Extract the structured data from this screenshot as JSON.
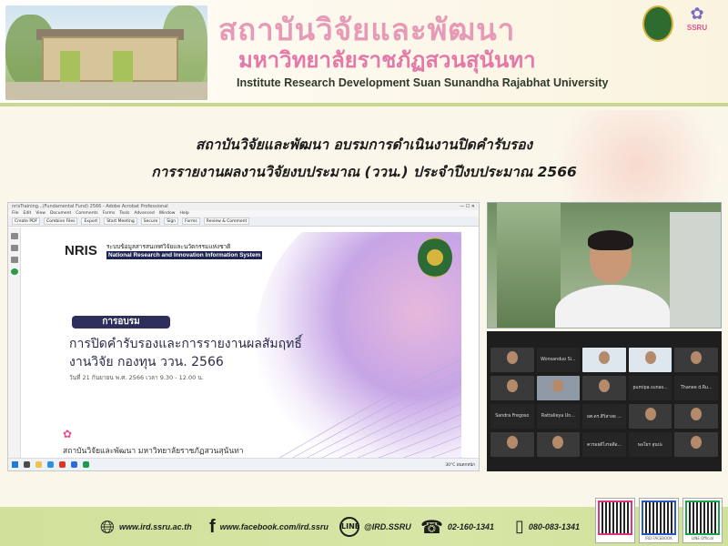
{
  "header": {
    "title_th_line1": "สถาบันวิจัยและพัฒนา",
    "title_th_line2": "มหาวิทยาลัยราชภัฏสวนสุนันทา",
    "title_en": "Institute Research Development Suan Sunandha Rajabhat University",
    "logo_text": "SSRU"
  },
  "headline": {
    "line1": "สถาบันวิจัยและพัฒนา อบรมการดำเนินงานปิดคำรับรอง",
    "line2": "การรายงานผลงานวิจัยงบประมาณ (ววน.) ประจำปีงบประมาณ 2566"
  },
  "screen_share": {
    "window_title": "nrisTraining...(Fundamental Fund) 2566 - Adobe Acrobat Professional",
    "menu": [
      "File",
      "Edit",
      "View",
      "Document",
      "Comments",
      "Forms",
      "Tools",
      "Advanced",
      "Window",
      "Help"
    ],
    "toolbar": [
      "Create PDF",
      "Combine Files",
      "Export",
      "Start Meeting",
      "Secure",
      "Sign",
      "Forms",
      "Review & Comment"
    ],
    "slide": {
      "nris_logo": "NRIS",
      "nris_th": "ระบบข้อมูลสารสนเทศวิจัยและนวัตกรรมแห่งชาติ",
      "nris_en": "National Research and Innovation Information System",
      "training_label": "การอบรม",
      "heading_line1": "การปิดคำรับรองและการรายงานผลสัมฤทธิ์",
      "heading_line2": "งานวิจัย กองทุน ววน. 2566",
      "date_line": "วันที่ 21 กันยายน พ.ศ. 2566 เวลา 9.30 - 12.00 น.",
      "footer": "สถาบันวิจัยและพัฒนา มหาวิทยาลัยราชภัฏสวนสุนันทา"
    },
    "taskbar_tray": "30°C ฝนตกหนัก"
  },
  "participants": [
    {
      "name": ""
    },
    {
      "name": "Wonsanduo Si..."
    },
    {
      "name": ""
    },
    {
      "name": ""
    },
    {
      "name": ""
    },
    {
      "name": ""
    },
    {
      "name": ""
    },
    {
      "name": ""
    },
    {
      "name": "pumipa.sunas..."
    },
    {
      "name": "Thanee d.Ru..."
    },
    {
      "name": "Sandra Fregoso"
    },
    {
      "name": "Rattalieya Un..."
    },
    {
      "name": "ผศ.ดร.สีวิสาลย ..."
    },
    {
      "name": ""
    },
    {
      "name": ""
    },
    {
      "name": ""
    },
    {
      "name": ""
    },
    {
      "name": "ควรอยดีไงรอดีอ..."
    },
    {
      "name": "พลโยร สุนปะ"
    },
    {
      "name": ""
    }
  ],
  "footer": {
    "website": "www.ird.ssru.ac.th",
    "facebook": "www.facebook.com/ird.ssru",
    "line": "@IRD.SSRU",
    "phone": "02-160-1341",
    "mobile": "080-083-1341",
    "line_icon_label": "LINE",
    "qr_captions": [
      "",
      "IRD FACEBOOK",
      "LINE Official"
    ]
  },
  "colors": {
    "title_pink": "#e79ab6",
    "footer_green": "#cfe19a",
    "banner_border": "#c8d98e"
  }
}
